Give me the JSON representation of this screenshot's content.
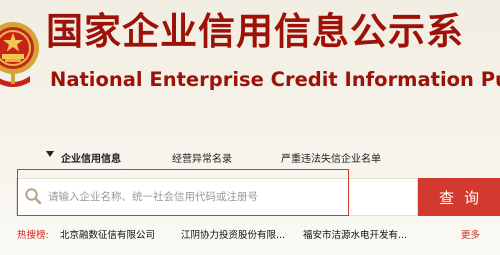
{
  "header": {
    "title_cn": "国家企业信用信息公示系",
    "title_en": "National Enterprise Credit Information Publicity S",
    "emblem_icon": "national-emblem-icon"
  },
  "nav": {
    "tabs": [
      {
        "label": "企业信用信息",
        "active": true
      },
      {
        "label": "经营异常名录",
        "active": false
      },
      {
        "label": "严重违法失信企业名单",
        "active": false
      }
    ]
  },
  "search": {
    "placeholder": "请输入企业名称、统一社会信用代码或注册号",
    "value": "",
    "button_label": "查询",
    "icon": "search-icon"
  },
  "hot_search": {
    "label": "热搜榜:",
    "items": [
      "北京融数征信有限公司",
      "江阴协力投资股份有限...",
      "福安市洁源水电开发有..."
    ],
    "more_label": "更多"
  },
  "colors": {
    "brand_red": "#9c1209",
    "button_red": "#d33a2f",
    "hot_red": "#d3261b"
  }
}
